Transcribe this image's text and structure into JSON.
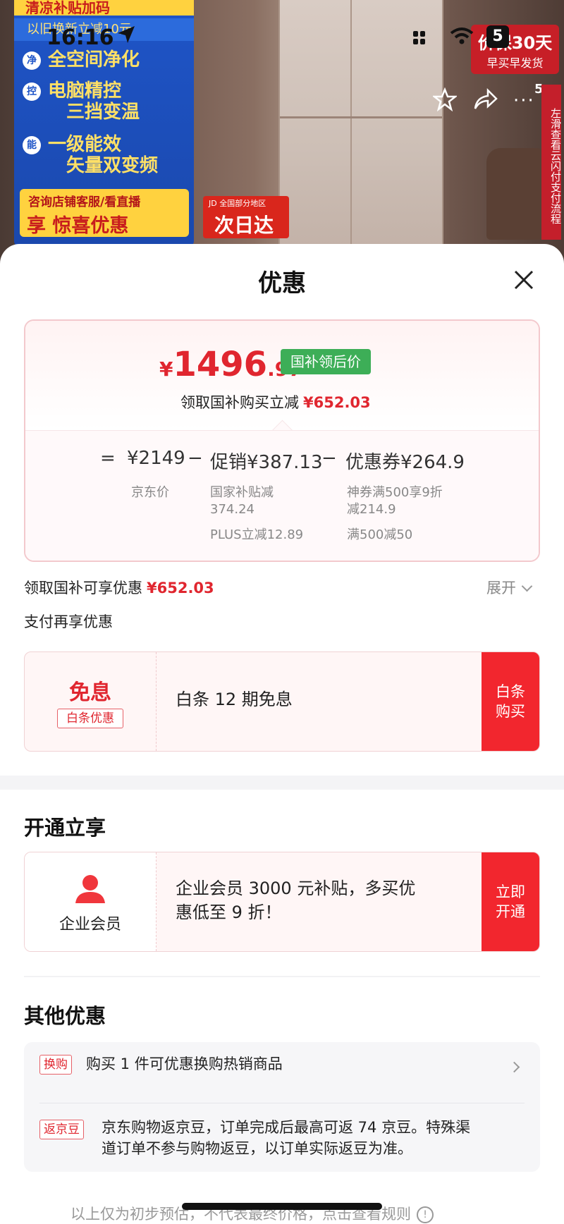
{
  "status_bar": {
    "time": "16:16",
    "battery": "5"
  },
  "background": {
    "promo_top": "清凉补贴加码",
    "promo_sub": "以旧换新立减10元",
    "promo_lines": [
      {
        "num": "净",
        "line1": "全空间净化",
        "line2": ""
      },
      {
        "num": "控",
        "line1": "电脑精控",
        "line2": "三挡变温"
      },
      {
        "num": "能",
        "line1": "一级能效",
        "line2": "矢量双变频"
      }
    ],
    "consult_line": "咨询店铺客服/看直播",
    "consult_big": "享 惊喜优惠",
    "jd_badge_small": "JD 全国部分地区",
    "jd_badge_big": "次日达",
    "deal_line1": "价保30天",
    "deal_line2": "早买早发货",
    "side_count": "5+",
    "side_tab": "左滑查看云闪付支付流程"
  },
  "sheet": {
    "title": "优惠",
    "price": {
      "yen": "¥",
      "integer": "1496",
      "decimal": ".97",
      "tag": "国补领后价"
    },
    "reduce": {
      "label": "领取国补购买立减",
      "amount": "¥652.03"
    },
    "formula": {
      "equals": "=",
      "jd_price": "¥2149",
      "minus1": "−",
      "promo": "促销¥387.13",
      "minus2": "−",
      "coupon": "优惠券¥264.9",
      "jd_price_label": "京东价",
      "promo_detail_1": "国家补贴减",
      "promo_detail_1b": "374.24",
      "promo_detail_2": "PLUS立减12.89",
      "coupon_detail_1": "神券满500享9折",
      "coupon_detail_1b": "减214.9",
      "coupon_detail_2": "满500减50"
    },
    "gov_row": {
      "label": "领取国补可享优惠",
      "amount": "¥652.03",
      "expand": "展开"
    },
    "pay_title": "支付再享优惠",
    "baitiao": {
      "big": "免息",
      "tag": "白条优惠",
      "desc": "白条 12 期免息",
      "cta_line1": "白条",
      "cta_line2": "购买"
    },
    "open_title": "开通立享",
    "member": {
      "label": "企业会员",
      "desc_line1": "企业会员 3000 元补贴，多买优",
      "desc_line2": "惠低至 9 折！",
      "cta_line1": "立即",
      "cta_line2": "开通"
    },
    "other_title": "其他优惠",
    "other": [
      {
        "tag": "换购",
        "text": "购买 1 件可优惠换购热销商品"
      },
      {
        "tag": "返京豆",
        "text_line1": "京东购物返京豆，订单完成后最高可返 74 京豆。特殊渠",
        "text_line2": "道订单不参与购物返豆，以订单实际返豆为准。"
      }
    ],
    "footer": "以上仅为初步预估，不代表最终价格，点击查看规则"
  }
}
